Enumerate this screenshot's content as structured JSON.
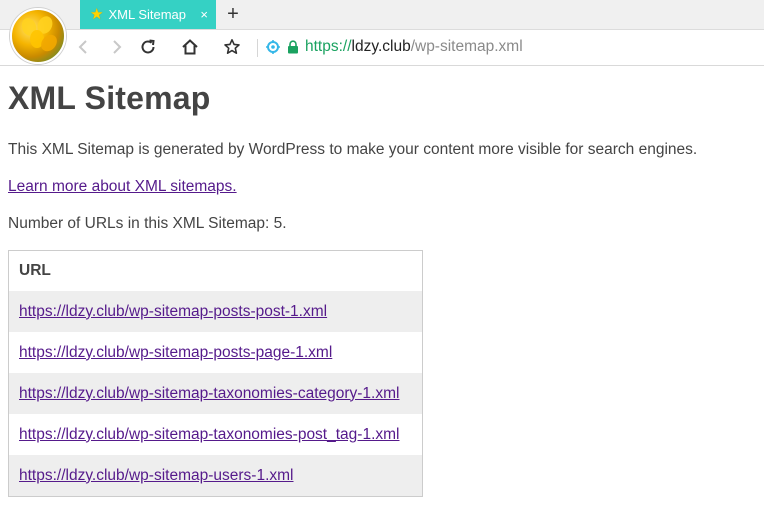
{
  "browser": {
    "tab": {
      "title": "XML Sitemap",
      "close_glyph": "×",
      "icon": "star-icon"
    },
    "new_tab_glyph": "+",
    "address": {
      "scheme": "https://",
      "host": "ldzy.club",
      "path": "/wp-sitemap.xml"
    },
    "colors": {
      "tab_active": "#35d1c4",
      "secure": "#1aa260"
    }
  },
  "page": {
    "title": "XML Sitemap",
    "description": "This XML Sitemap is generated by WordPress to make your content more visible for search engines.",
    "learn_more": "Learn more about XML sitemaps.",
    "count_text": "Number of URLs in this XML Sitemap: 5.",
    "table": {
      "header": "URL",
      "rows": [
        "https://ldzy.club/wp-sitemap-posts-post-1.xml",
        "https://ldzy.club/wp-sitemap-posts-page-1.xml",
        "https://ldzy.club/wp-sitemap-taxonomies-category-1.xml",
        "https://ldzy.club/wp-sitemap-taxonomies-post_tag-1.xml",
        "https://ldzy.club/wp-sitemap-users-1.xml"
      ]
    },
    "colors": {
      "text": "#444444",
      "link_visited": "#551a8b",
      "row_stripe": "#eeeeee"
    }
  }
}
